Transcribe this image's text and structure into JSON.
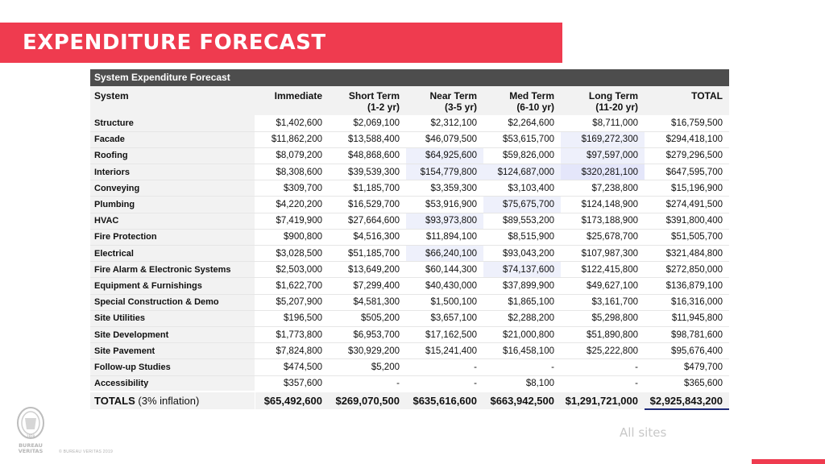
{
  "banner": {
    "title": "EXPENDITURE FORECAST"
  },
  "table": {
    "title": "System Expenditure Forecast",
    "headers": {
      "system": "System",
      "immediate": "Immediate",
      "short_1": "Short Term",
      "short_2": "(1-2 yr)",
      "near_1": "Near Term",
      "near_2": "(3-5 yr)",
      "med_1": "Med Term",
      "med_2": "(6-10 yr)",
      "long_1": "Long Term",
      "long_2": "(11-20 yr)",
      "total": "TOTAL"
    },
    "rows": [
      {
        "name": "Structure",
        "immediate": "$1,402,600",
        "short": "$2,069,100",
        "near": "$2,312,100",
        "med": "$2,264,600",
        "long": "$8,711,000",
        "total": "$16,759,500"
      },
      {
        "name": "Facade",
        "immediate": "$11,862,200",
        "short": "$13,588,400",
        "near": "$46,079,500",
        "med": "$53,615,700",
        "long": "$169,272,300",
        "total": "$294,418,100"
      },
      {
        "name": "Roofing",
        "immediate": "$8,079,200",
        "short": "$48,868,600",
        "near": "$64,925,600",
        "med": "$59,826,000",
        "long": "$97,597,000",
        "total": "$279,296,500"
      },
      {
        "name": "Interiors",
        "immediate": "$8,308,600",
        "short": "$39,539,300",
        "near": "$154,779,800",
        "med": "$124,687,000",
        "long": "$320,281,100",
        "total": "$647,595,700"
      },
      {
        "name": "Conveying",
        "immediate": "$309,700",
        "short": "$1,185,700",
        "near": "$3,359,300",
        "med": "$3,103,400",
        "long": "$7,238,800",
        "total": "$15,196,900"
      },
      {
        "name": "Plumbing",
        "immediate": "$4,220,200",
        "short": "$16,529,700",
        "near": "$53,916,900",
        "med": "$75,675,700",
        "long": "$124,148,900",
        "total": "$274,491,500"
      },
      {
        "name": "HVAC",
        "immediate": "$7,419,900",
        "short": "$27,664,600",
        "near": "$93,973,800",
        "med": "$89,553,200",
        "long": "$173,188,900",
        "total": "$391,800,400"
      },
      {
        "name": "Fire Protection",
        "immediate": "$900,800",
        "short": "$4,516,300",
        "near": "$11,894,100",
        "med": "$8,515,900",
        "long": "$25,678,700",
        "total": "$51,505,700"
      },
      {
        "name": "Electrical",
        "immediate": "$3,028,500",
        "short": "$51,185,700",
        "near": "$66,240,100",
        "med": "$93,043,200",
        "long": "$107,987,300",
        "total": "$321,484,800"
      },
      {
        "name": "Fire Alarm & Electronic Systems",
        "immediate": "$2,503,000",
        "short": "$13,649,200",
        "near": "$60,144,300",
        "med": "$74,137,600",
        "long": "$122,415,800",
        "total": "$272,850,000"
      },
      {
        "name": "Equipment & Furnishings",
        "immediate": "$1,622,700",
        "short": "$7,299,400",
        "near": "$40,430,000",
        "med": "$37,899,900",
        "long": "$49,627,100",
        "total": "$136,879,100"
      },
      {
        "name": "Special Construction & Demo",
        "immediate": "$5,207,900",
        "short": "$4,581,300",
        "near": "$1,500,100",
        "med": "$1,865,100",
        "long": "$3,161,700",
        "total": "$16,316,000"
      },
      {
        "name": "Site Utilities",
        "immediate": "$196,500",
        "short": "$505,200",
        "near": "$3,657,100",
        "med": "$2,288,200",
        "long": "$5,298,800",
        "total": "$11,945,800"
      },
      {
        "name": "Site Development",
        "immediate": "$1,773,800",
        "short": "$6,953,700",
        "near": "$17,162,500",
        "med": "$21,000,800",
        "long": "$51,890,800",
        "total": "$98,781,600"
      },
      {
        "name": "Site Pavement",
        "immediate": "$7,824,800",
        "short": "$30,929,200",
        "near": "$15,241,400",
        "med": "$16,458,100",
        "long": "$25,222,800",
        "total": "$95,676,400"
      },
      {
        "name": "Follow-up Studies",
        "immediate": "$474,500",
        "short": "$5,200",
        "near": "-",
        "med": "-",
        "long": "-",
        "total": "$479,700"
      },
      {
        "name": "Accessibility",
        "immediate": "$357,600",
        "short": "-",
        "near": "-",
        "med": "$8,100",
        "long": "-",
        "total": "$365,600"
      }
    ],
    "totals": {
      "label": "TOTALS",
      "label_suffix": " (3% inflation)",
      "immediate": "$65,492,600",
      "short": "$269,070,500",
      "near": "$635,616,600",
      "med": "$663,942,500",
      "long": "$1,291,721,000",
      "total": "$2,925,843,200"
    }
  },
  "footer": {
    "copyright": "©  BUREAU VERITAS 2019",
    "note": "All sites",
    "logo_text": "BUREAU VERITAS",
    "logo_year": "1828"
  },
  "colors": {
    "accent": "#ef3b4f",
    "header_bg": "#4d4d4d",
    "highlight": "#eef0fb"
  }
}
